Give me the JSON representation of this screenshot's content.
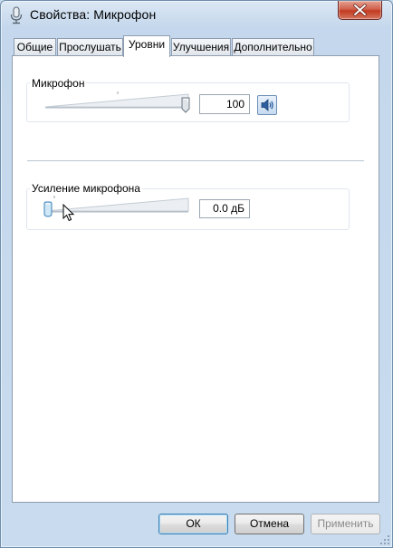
{
  "window": {
    "title": "Свойства: Микрофон"
  },
  "tabs": [
    {
      "label": "Общие",
      "active": false
    },
    {
      "label": "Прослушать",
      "active": false
    },
    {
      "label": "Уровни",
      "active": true
    },
    {
      "label": "Улучшения",
      "active": false
    },
    {
      "label": "Дополнительно",
      "active": false
    }
  ],
  "levels": {
    "microphone": {
      "label": "Микрофон",
      "value": "100",
      "level_fraction": 1.0,
      "mute_icon": "speaker-icon"
    },
    "boost": {
      "label": "Усиление микрофона",
      "value": "0.0 дБ",
      "level_fraction": 0.0
    }
  },
  "buttons": {
    "ok": "ОК",
    "cancel": "Отмена",
    "apply": "Применить",
    "apply_enabled": false
  },
  "colors": {
    "frame": "#c9dcee",
    "close_button": "#c23b22",
    "default_button_border": "#3c7fb1"
  }
}
